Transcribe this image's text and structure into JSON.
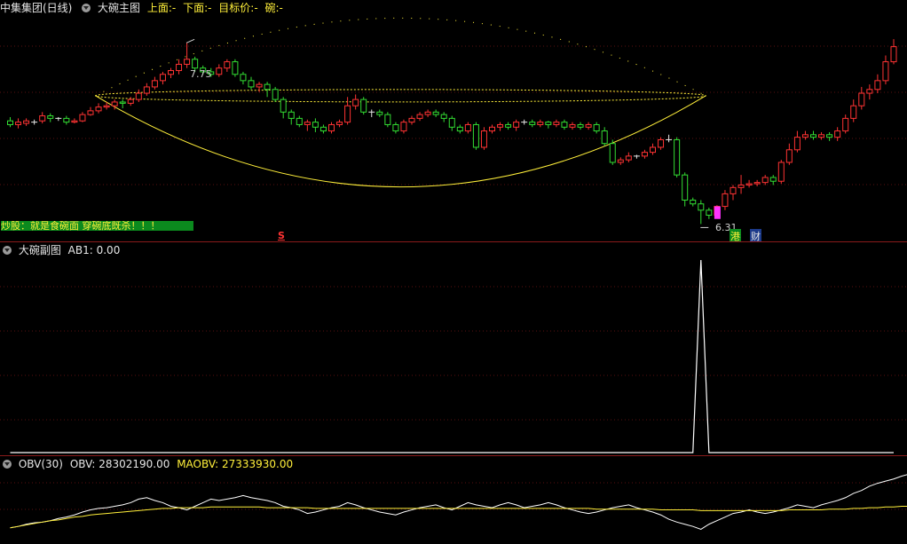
{
  "main_panel": {
    "stock_name": "中集集团(日线)",
    "indicator_name": "大碗主图",
    "upper_label": "上面:-",
    "lower_label": "下面:-",
    "target_label": "目标价:-",
    "bowl_label": "碗:-",
    "banner_text": "炒股：就是食碗面 穿碗底既杀！！！",
    "high_label": "7.75",
    "low_label": "6.31",
    "marker_s": "S",
    "tag_gang": "港",
    "tag_cai": "财",
    "colors": {
      "up": "#ff3333",
      "down": "#33dd33",
      "bowl": "#ffef3a",
      "marker": "#ff33ff"
    }
  },
  "sub_panel": {
    "indicator_name": "大碗副图",
    "ab1_label": "AB1: 0.00"
  },
  "obv_panel": {
    "indicator_name": "OBV(30)",
    "obv_label": "OBV: 28302190.00",
    "maobv_label": "MAOBV: 27333930.00"
  },
  "chart_data": {
    "type": "candlestick",
    "candles": [
      [
        7.13,
        7.1,
        7.16,
        7.08
      ],
      [
        7.1,
        7.12,
        7.15,
        7.07
      ],
      [
        7.11,
        7.13,
        7.15,
        7.09
      ],
      [
        7.12,
        7.12,
        7.14,
        7.1
      ],
      [
        7.13,
        7.17,
        7.2,
        7.11
      ],
      [
        7.17,
        7.15,
        7.19,
        7.12
      ],
      [
        7.15,
        7.15,
        7.16,
        7.13
      ],
      [
        7.15,
        7.12,
        7.17,
        7.1
      ],
      [
        7.12,
        7.13,
        7.15,
        7.11
      ],
      [
        7.13,
        7.18,
        7.2,
        7.12
      ],
      [
        7.18,
        7.21,
        7.24,
        7.17
      ],
      [
        7.21,
        7.24,
        7.27,
        7.19
      ],
      [
        7.24,
        7.25,
        7.28,
        7.22
      ],
      [
        7.25,
        7.28,
        7.3,
        7.22
      ],
      [
        7.28,
        7.27,
        7.3,
        7.23
      ],
      [
        7.27,
        7.3,
        7.32,
        7.25
      ],
      [
        7.3,
        7.35,
        7.38,
        7.28
      ],
      [
        7.35,
        7.4,
        7.43,
        7.33
      ],
      [
        7.4,
        7.45,
        7.48,
        7.38
      ],
      [
        7.45,
        7.5,
        7.52,
        7.42
      ],
      [
        7.5,
        7.53,
        7.55,
        7.47
      ],
      [
        7.53,
        7.58,
        7.62,
        7.5
      ],
      [
        7.58,
        7.62,
        7.75,
        7.55
      ],
      [
        7.62,
        7.55,
        7.64,
        7.52
      ],
      [
        7.55,
        7.52,
        7.57,
        7.5
      ],
      [
        7.52,
        7.5,
        7.55,
        7.48
      ],
      [
        7.5,
        7.55,
        7.58,
        7.48
      ],
      [
        7.55,
        7.6,
        7.62,
        7.52
      ],
      [
        7.6,
        7.5,
        7.62,
        7.48
      ],
      [
        7.5,
        7.45,
        7.52,
        7.42
      ],
      [
        7.45,
        7.4,
        7.48,
        7.38
      ],
      [
        7.4,
        7.42,
        7.44,
        7.36
      ],
      [
        7.42,
        7.38,
        7.44,
        7.32
      ],
      [
        7.38,
        7.3,
        7.4,
        7.28
      ],
      [
        7.3,
        7.2,
        7.32,
        7.15
      ],
      [
        7.2,
        7.15,
        7.22,
        7.1
      ],
      [
        7.15,
        7.1,
        7.17,
        7.08
      ],
      [
        7.1,
        7.12,
        7.14,
        7.05
      ],
      [
        7.12,
        7.08,
        7.15,
        7.04
      ],
      [
        7.08,
        7.05,
        7.1,
        7.03
      ],
      [
        7.05,
        7.1,
        7.12,
        7.03
      ],
      [
        7.1,
        7.12,
        7.14,
        7.08
      ],
      [
        7.12,
        7.25,
        7.32,
        7.1
      ],
      [
        7.25,
        7.3,
        7.34,
        7.22
      ],
      [
        7.3,
        7.2,
        7.32,
        7.18
      ],
      [
        7.2,
        7.2,
        7.22,
        7.16
      ],
      [
        7.2,
        7.18,
        7.22,
        7.16
      ],
      [
        7.18,
        7.1,
        7.2,
        7.08
      ],
      [
        7.1,
        7.05,
        7.12,
        7.03
      ],
      [
        7.05,
        7.12,
        7.14,
        7.03
      ],
      [
        7.12,
        7.15,
        7.17,
        7.1
      ],
      [
        7.15,
        7.18,
        7.2,
        7.13
      ],
      [
        7.18,
        7.2,
        7.22,
        7.16
      ],
      [
        7.2,
        7.18,
        7.22,
        7.16
      ],
      [
        7.18,
        7.15,
        7.2,
        7.12
      ],
      [
        7.15,
        7.08,
        7.17,
        7.05
      ],
      [
        7.08,
        7.05,
        7.1,
        7.03
      ],
      [
        7.05,
        7.1,
        7.12,
        7.03
      ],
      [
        7.1,
        6.92,
        7.12,
        6.9
      ],
      [
        6.92,
        7.05,
        7.08,
        6.9
      ],
      [
        7.05,
        7.08,
        7.1,
        7.03
      ],
      [
        7.08,
        7.1,
        7.12,
        7.05
      ],
      [
        7.1,
        7.08,
        7.12,
        7.06
      ],
      [
        7.08,
        7.12,
        7.14,
        7.05
      ],
      [
        7.12,
        7.12,
        7.14,
        7.1
      ],
      [
        7.12,
        7.1,
        7.14,
        7.08
      ],
      [
        7.1,
        7.12,
        7.14,
        7.08
      ],
      [
        7.12,
        7.1,
        7.13,
        7.07
      ],
      [
        7.1,
        7.12,
        7.14,
        7.08
      ],
      [
        7.12,
        7.08,
        7.14,
        7.06
      ],
      [
        7.08,
        7.1,
        7.12,
        7.06
      ],
      [
        7.1,
        7.08,
        7.12,
        7.06
      ],
      [
        7.08,
        7.1,
        7.12,
        7.06
      ],
      [
        7.1,
        7.05,
        7.12,
        7.03
      ],
      [
        7.05,
        6.95,
        7.08,
        6.93
      ],
      [
        6.95,
        6.8,
        6.98,
        6.78
      ],
      [
        6.8,
        6.82,
        6.84,
        6.78
      ],
      [
        6.82,
        6.85,
        6.88,
        6.8
      ],
      [
        6.85,
        6.85,
        6.86,
        6.83
      ],
      [
        6.85,
        6.88,
        6.9,
        6.83
      ],
      [
        6.88,
        6.92,
        6.95,
        6.86
      ],
      [
        6.92,
        6.98,
        7.0,
        6.9
      ],
      [
        6.98,
        6.98,
        7.02,
        6.96
      ],
      [
        6.98,
        6.7,
        7.0,
        6.68
      ],
      [
        6.7,
        6.5,
        6.72,
        6.45
      ],
      [
        6.5,
        6.47,
        6.52,
        6.45
      ],
      [
        6.47,
        6.42,
        6.5,
        6.31
      ],
      [
        6.42,
        6.38,
        6.44,
        6.35
      ],
      [
        6.38,
        6.45,
        6.46,
        6.36
      ],
      [
        6.45,
        6.55,
        6.58,
        6.42
      ],
      [
        6.55,
        6.6,
        6.62,
        6.5
      ],
      [
        6.6,
        6.62,
        6.7,
        6.55
      ],
      [
        6.62,
        6.63,
        6.66,
        6.6
      ],
      [
        6.63,
        6.64,
        6.66,
        6.61
      ],
      [
        6.64,
        6.68,
        6.7,
        6.62
      ],
      [
        6.68,
        6.65,
        6.7,
        6.62
      ],
      [
        6.65,
        6.8,
        6.82,
        6.63
      ],
      [
        6.8,
        6.9,
        6.95,
        6.78
      ],
      [
        6.9,
        7.0,
        7.05,
        6.88
      ],
      [
        7.0,
        7.02,
        7.05,
        6.98
      ],
      [
        7.02,
        7.0,
        7.05,
        6.98
      ],
      [
        7.0,
        7.02,
        7.04,
        6.98
      ],
      [
        7.02,
        7.0,
        7.04,
        6.97
      ],
      [
        7.0,
        7.05,
        7.08,
        6.97
      ],
      [
        7.05,
        7.15,
        7.18,
        7.03
      ],
      [
        7.15,
        7.25,
        7.3,
        7.12
      ],
      [
        7.25,
        7.35,
        7.4,
        7.22
      ],
      [
        7.35,
        7.38,
        7.42,
        7.3
      ],
      [
        7.38,
        7.45,
        7.5,
        7.35
      ],
      [
        7.45,
        7.6,
        7.65,
        7.42
      ],
      [
        7.6,
        7.72,
        7.78,
        7.58
      ]
    ],
    "ab1_peak": {
      "index": 86,
      "ab1": 1
    },
    "obv": [
      0.2,
      0.22,
      0.25,
      0.27,
      0.28,
      0.3,
      0.33,
      0.35,
      0.38,
      0.42,
      0.45,
      0.47,
      0.48,
      0.5,
      0.52,
      0.55,
      0.6,
      0.62,
      0.58,
      0.55,
      0.5,
      0.48,
      0.45,
      0.5,
      0.55,
      0.6,
      0.58,
      0.6,
      0.62,
      0.65,
      0.62,
      0.6,
      0.58,
      0.55,
      0.5,
      0.48,
      0.45,
      0.4,
      0.42,
      0.45,
      0.48,
      0.5,
      0.55,
      0.52,
      0.48,
      0.45,
      0.42,
      0.4,
      0.38,
      0.42,
      0.45,
      0.48,
      0.5,
      0.52,
      0.48,
      0.45,
      0.5,
      0.55,
      0.52,
      0.5,
      0.48,
      0.52,
      0.55,
      0.52,
      0.48,
      0.5,
      0.52,
      0.55,
      0.52,
      0.48,
      0.45,
      0.42,
      0.4,
      0.42,
      0.45,
      0.48,
      0.5,
      0.52,
      0.48,
      0.45,
      0.42,
      0.38,
      0.32,
      0.28,
      0.25,
      0.22,
      0.18,
      0.25,
      0.3,
      0.35,
      0.4,
      0.42,
      0.45,
      0.42,
      0.4,
      0.42,
      0.45,
      0.48,
      0.52,
      0.5,
      0.48,
      0.52,
      0.55,
      0.58,
      0.62,
      0.68,
      0.72,
      0.78,
      0.82,
      0.85,
      0.88,
      0.92,
      0.95
    ],
    "maobv": [
      0.2,
      0.22,
      0.24,
      0.26,
      0.28,
      0.3,
      0.31,
      0.33,
      0.35,
      0.36,
      0.38,
      0.39,
      0.4,
      0.41,
      0.42,
      0.43,
      0.44,
      0.45,
      0.46,
      0.47,
      0.47,
      0.48,
      0.48,
      0.48,
      0.48,
      0.49,
      0.49,
      0.49,
      0.49,
      0.49,
      0.49,
      0.49,
      0.48,
      0.48,
      0.48,
      0.48,
      0.48,
      0.48,
      0.47,
      0.47,
      0.47,
      0.47,
      0.47,
      0.47,
      0.47,
      0.47,
      0.47,
      0.47,
      0.47,
      0.47,
      0.47,
      0.47,
      0.47,
      0.47,
      0.47,
      0.47,
      0.47,
      0.47,
      0.47,
      0.47,
      0.47,
      0.47,
      0.47,
      0.47,
      0.47,
      0.47,
      0.47,
      0.47,
      0.47,
      0.47,
      0.47,
      0.47,
      0.47,
      0.46,
      0.46,
      0.46,
      0.46,
      0.46,
      0.46,
      0.46,
      0.46,
      0.45,
      0.45,
      0.45,
      0.45,
      0.45,
      0.44,
      0.44,
      0.44,
      0.44,
      0.44,
      0.44,
      0.44,
      0.44,
      0.44,
      0.44,
      0.44,
      0.45,
      0.45,
      0.45,
      0.45,
      0.45,
      0.46,
      0.46,
      0.46,
      0.47,
      0.47,
      0.48,
      0.48,
      0.49,
      0.49,
      0.5,
      0.5
    ]
  }
}
